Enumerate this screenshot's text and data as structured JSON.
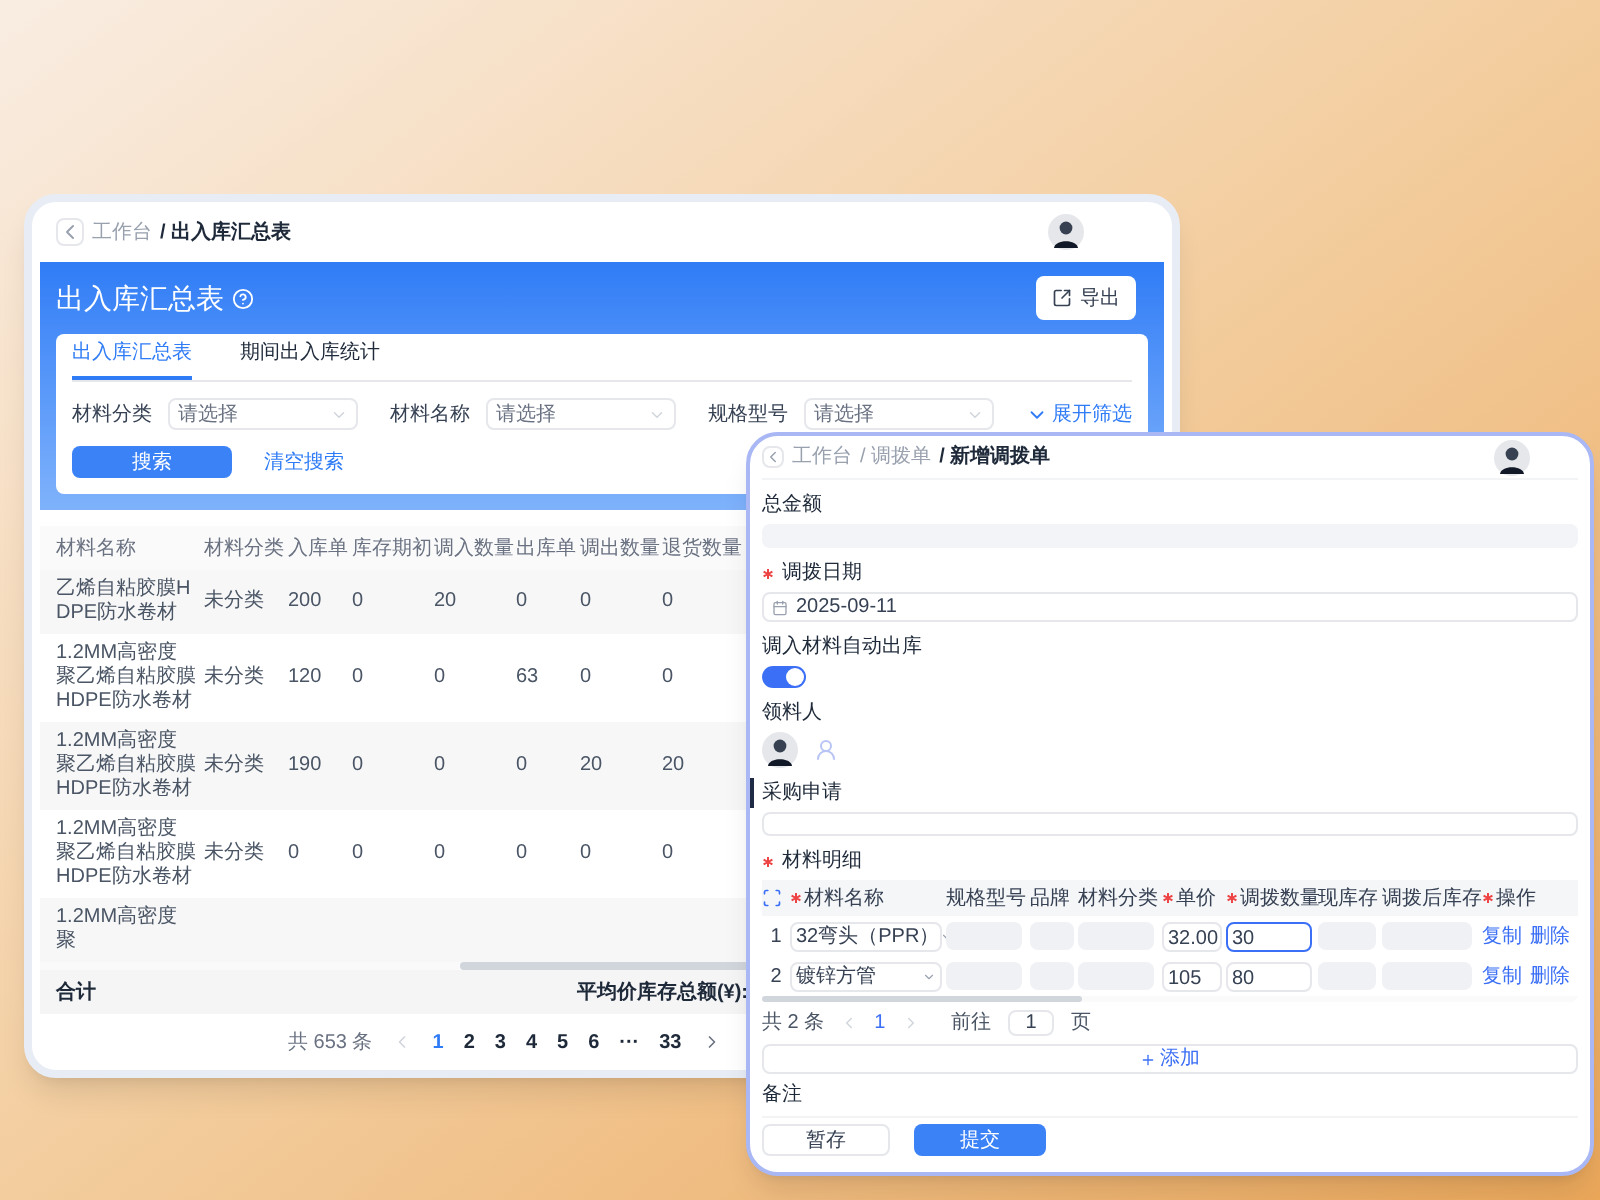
{
  "main_window": {
    "breadcrumb": [
      {
        "label": "工作台",
        "current": false
      },
      {
        "label": "/ 出入库汇总表",
        "current": true
      }
    ],
    "title": "出入库汇总表",
    "export_button": "导出",
    "tabs": [
      {
        "label": "出入库汇总表",
        "selected": true
      },
      {
        "label": "期间出入库统计",
        "selected": false
      }
    ],
    "filters": [
      {
        "label": "材料分类",
        "placeholder": "请选择"
      },
      {
        "label": "材料名称",
        "placeholder": "请选择"
      },
      {
        "label": "规格型号",
        "placeholder": "请选择"
      }
    ],
    "expand_filter": "展开筛选",
    "search_button": "搜索",
    "clear_link": "清空搜索",
    "table": {
      "columns": [
        "材料名称",
        "材料分类",
        "入库单",
        "库存期初",
        "调入数量",
        "出库单",
        "调出数量",
        "退货数量"
      ],
      "rows": [
        {
          "cells": [
            "乙烯自粘胶膜HDPE防水卷材",
            "未分类",
            "200",
            "0",
            "20",
            "0",
            "0",
            "0"
          ]
        },
        {
          "cells": [
            "1.2MM高密度聚乙烯自粘胶膜HDPE防水卷材",
            "未分类",
            "120",
            "0",
            "0",
            "63",
            "0",
            "0"
          ]
        },
        {
          "cells": [
            "1.2MM高密度聚乙烯自粘胶膜HDPE防水卷材",
            "未分类",
            "190",
            "0",
            "0",
            "0",
            "20",
            "20"
          ]
        },
        {
          "cells": [
            "1.2MM高密度聚乙烯自粘胶膜HDPE防水卷材",
            "未分类",
            "0",
            "0",
            "0",
            "0",
            "0",
            "0"
          ]
        },
        {
          "cells": [
            "1.2MM高密度聚"
          ]
        }
      ]
    },
    "summary": {
      "label": "合计",
      "total_label": "平均价库存总额(¥):"
    },
    "pagination": {
      "total": "共 653 条",
      "pages": [
        {
          "label": "1",
          "selected": true
        },
        {
          "label": "2",
          "selected": false
        },
        {
          "label": "3",
          "selected": false
        },
        {
          "label": "4",
          "selected": false
        },
        {
          "label": "5",
          "selected": false
        },
        {
          "label": "6",
          "selected": false
        },
        {
          "label": "···",
          "selected": false
        },
        {
          "label": "33",
          "selected": false
        }
      ]
    }
  },
  "form_window": {
    "breadcrumb": [
      {
        "label": "工作台",
        "current": false
      },
      {
        "label": "/ 调拨单",
        "current": false
      },
      {
        "label": "/ 新增调拨单",
        "current": true
      }
    ],
    "total_amount": {
      "label": "总金额"
    },
    "transfer_date": {
      "label": "调拨日期",
      "required": true,
      "value": "2025-09-11"
    },
    "auto_outbound": {
      "label": "调入材料自动出库",
      "on": true
    },
    "receiver": {
      "label": "领料人"
    },
    "purchase_request": {
      "label": "采购申请"
    },
    "materials": {
      "label": "材料明细",
      "required": true,
      "columns": [
        {
          "label": "材料名称",
          "required": true
        },
        {
          "label": "规格型号",
          "required": false
        },
        {
          "label": "品牌",
          "required": false
        },
        {
          "label": "材料分类",
          "required": false
        },
        {
          "label": "单价",
          "required": true
        },
        {
          "label": "调拨数量",
          "required": true
        },
        {
          "label": "现库存",
          "required": false
        },
        {
          "label": "调拨后库存",
          "required": false
        },
        {
          "label": "操作",
          "required": true
        }
      ],
      "rows": [
        {
          "index": "1",
          "name": "32弯头（PPR）",
          "price": "32.00",
          "quantity": "30",
          "focused": true,
          "actions": [
            "复制",
            "删除"
          ]
        },
        {
          "index": "2",
          "name": "镀锌方管",
          "price": "105",
          "quantity": "80",
          "focused": false,
          "actions": [
            "复制",
            "删除"
          ]
        }
      ]
    },
    "pagination": {
      "total": "共 2 条",
      "page": "1",
      "goto_label": "前往",
      "goto_value": "1",
      "page_suffix": "页"
    },
    "add_button": "添加",
    "remarks_label": "备注",
    "save_button": "暂存",
    "submit_button": "提交"
  }
}
